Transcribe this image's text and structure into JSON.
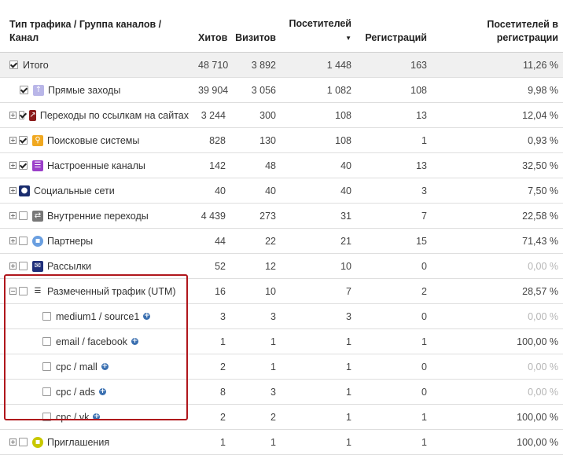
{
  "header": {
    "col_name": "Тип трафика / Группа каналов / Канал",
    "col_hits": "Хитов",
    "col_visits": "Визитов",
    "col_visitors": "Посетителей",
    "col_visitors_sort": "▼",
    "col_regs": "Регистраций",
    "col_conv": "Посетителей в регистрации"
  },
  "rows": [
    {
      "label": "Итого",
      "hits": "48 710",
      "visits": "3 892",
      "visitors": "1 448",
      "regs": "163",
      "conv": "11,26 %"
    },
    {
      "label": "Прямые заходы",
      "hits": "39 904",
      "visits": "3 056",
      "visitors": "1 082",
      "regs": "108",
      "conv": "9,98 %"
    },
    {
      "label": "Переходы по ссылкам на сайтах",
      "hits": "3 244",
      "visits": "300",
      "visitors": "108",
      "regs": "13",
      "conv": "12,04 %"
    },
    {
      "label": "Поисковые системы",
      "hits": "828",
      "visits": "130",
      "visitors": "108",
      "regs": "1",
      "conv": "0,93 %"
    },
    {
      "label": "Настроенные каналы",
      "hits": "142",
      "visits": "48",
      "visitors": "40",
      "regs": "13",
      "conv": "32,50 %"
    },
    {
      "label": "Социальные сети",
      "hits": "40",
      "visits": "40",
      "visitors": "40",
      "regs": "3",
      "conv": "7,50 %"
    },
    {
      "label": "Внутренние переходы",
      "hits": "4 439",
      "visits": "273",
      "visitors": "31",
      "regs": "7",
      "conv": "22,58 %"
    },
    {
      "label": "Партнеры",
      "hits": "44",
      "visits": "22",
      "visitors": "21",
      "regs": "15",
      "conv": "71,43 %"
    },
    {
      "label": "Рассылки",
      "hits": "52",
      "visits": "12",
      "visitors": "10",
      "regs": "0",
      "conv": "0,00 %"
    },
    {
      "label": "Размеченный трафик (UTM)",
      "hits": "16",
      "visits": "10",
      "visitors": "7",
      "regs": "2",
      "conv": "28,57 %"
    },
    {
      "label": "medium1 / source1",
      "hits": "3",
      "visits": "3",
      "visitors": "3",
      "regs": "0",
      "conv": "0,00 %"
    },
    {
      "label": "email / facebook",
      "hits": "1",
      "visits": "1",
      "visitors": "1",
      "regs": "1",
      "conv": "100,00 %"
    },
    {
      "label": "cpc / mall",
      "hits": "2",
      "visits": "1",
      "visitors": "1",
      "regs": "0",
      "conv": "0,00 %"
    },
    {
      "label": "cpc / ads",
      "hits": "8",
      "visits": "3",
      "visitors": "1",
      "regs": "0",
      "conv": "0,00 %"
    },
    {
      "label": "cpc / vk",
      "hits": "2",
      "visits": "2",
      "visitors": "1",
      "regs": "1",
      "conv": "100,00 %"
    },
    {
      "label": "Приглашения",
      "hits": "1",
      "visits": "1",
      "visitors": "1",
      "regs": "1",
      "conv": "100,00 %"
    }
  ],
  "glyphs": {
    "expand": "+",
    "collapse": "−",
    "plus": "+"
  },
  "colors": {
    "direct": "#b9b6e8",
    "links": "#8b1a1a",
    "search": "#f0a820",
    "custom": "#9b3fc9",
    "social": "#1a2d6e",
    "internal": "#777777",
    "partners": "#6a9fe0",
    "mail": "#1f2f7a",
    "invite": "#c8c800",
    "highlight": "#b0161c",
    "plus": "#3a6fb0"
  }
}
